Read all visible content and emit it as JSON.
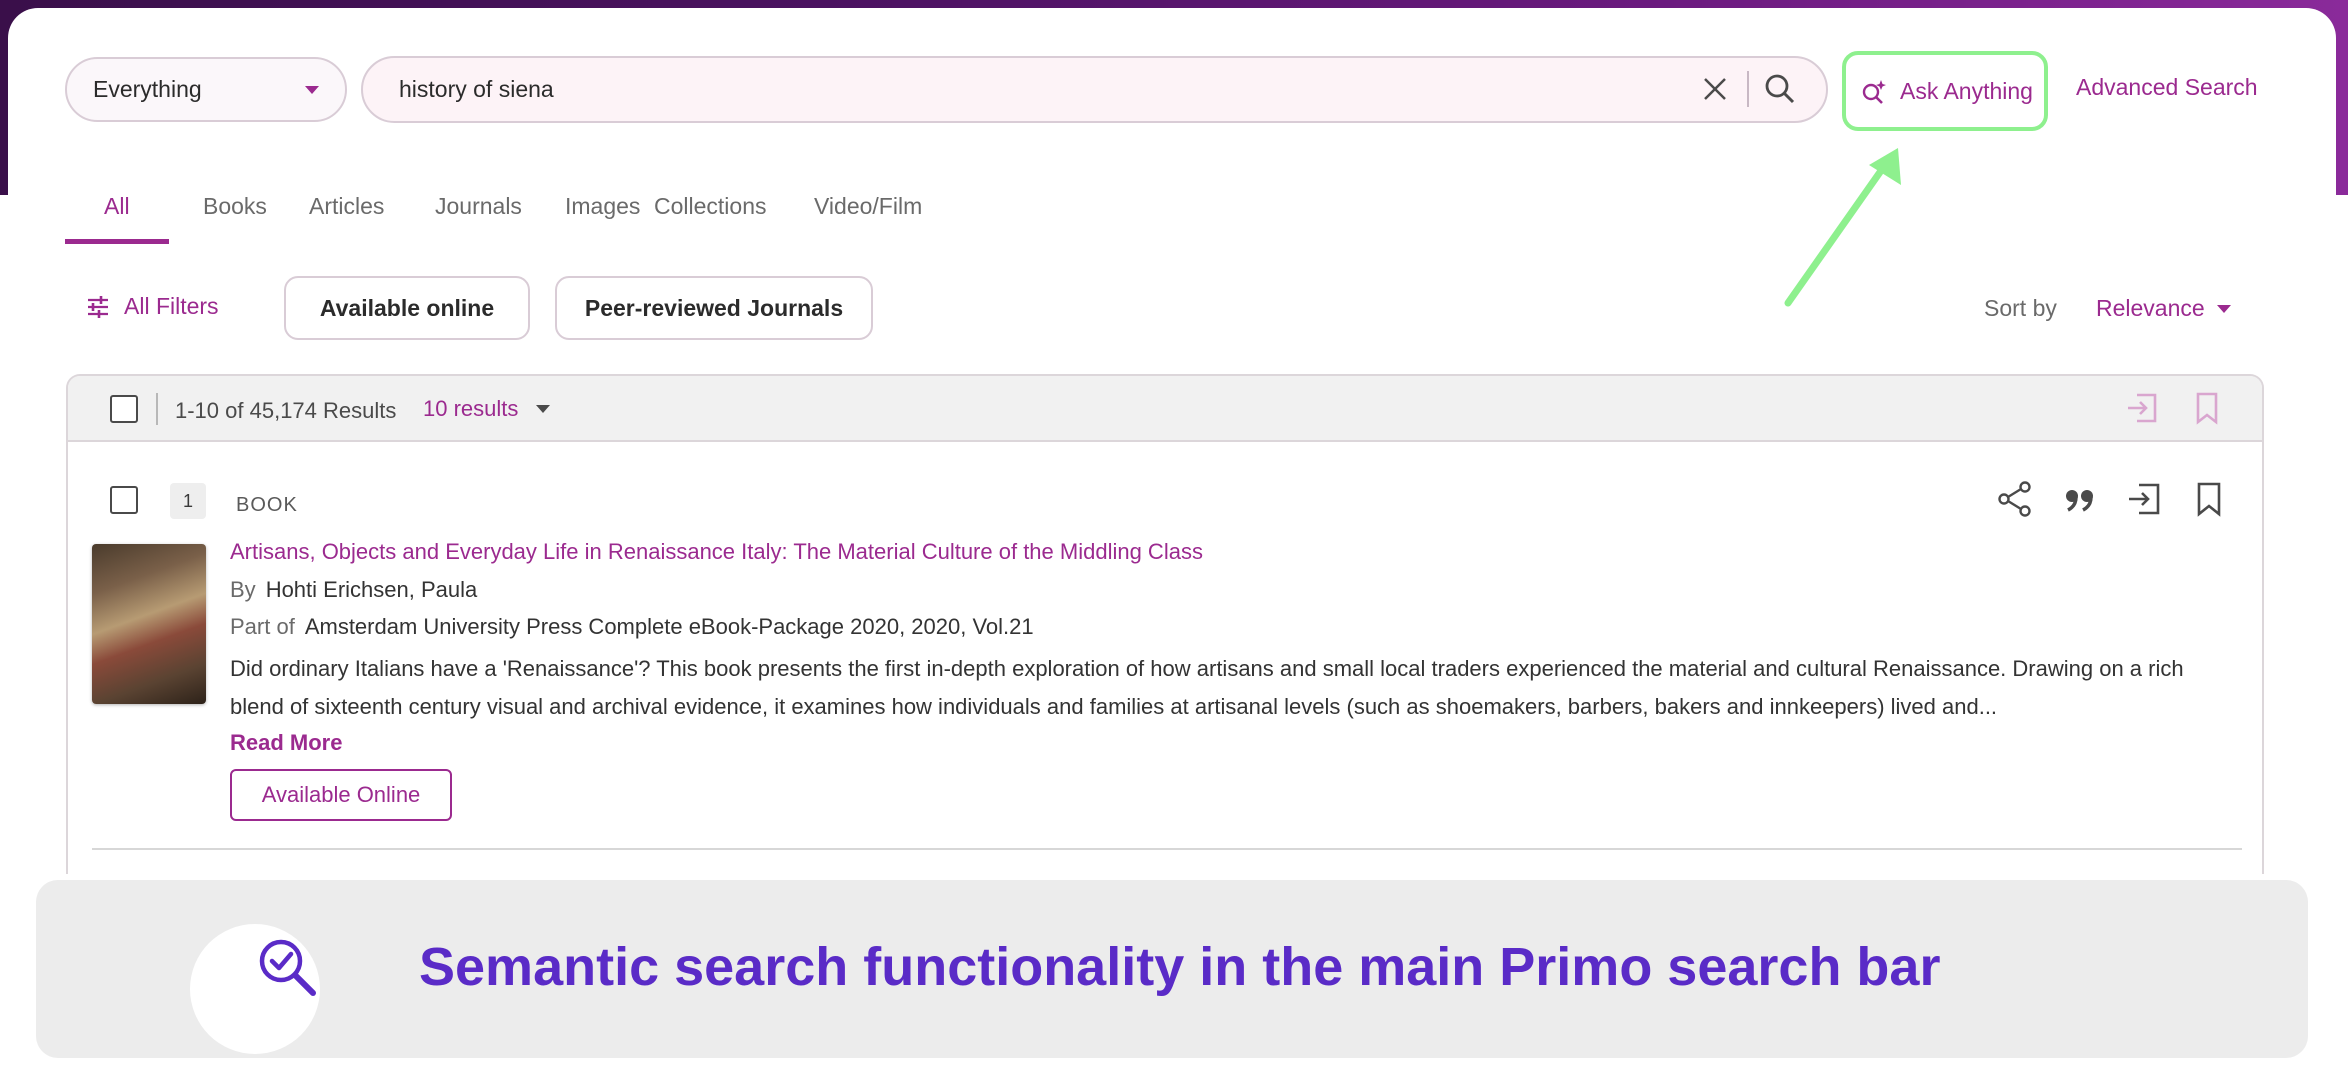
{
  "search": {
    "scope": "Everything",
    "query": "history of siena",
    "ask_anything_label": "Ask Anything",
    "advanced_search_label": "Advanced Search"
  },
  "tabs": [
    {
      "label": "All",
      "active": true
    },
    {
      "label": "Books"
    },
    {
      "label": "Articles"
    },
    {
      "label": "Journals"
    },
    {
      "label": "Images"
    },
    {
      "label": "Collections"
    },
    {
      "label": "Video/Film"
    }
  ],
  "filters": {
    "all_filters_label": "All Filters",
    "chips": [
      "Available online",
      "Peer-reviewed Journals"
    ],
    "sort_label": "Sort by",
    "sort_value": "Relevance"
  },
  "results_header": {
    "count_text": "1-10 of 45,174 Results",
    "per_page": "10 results"
  },
  "results": [
    {
      "number": "1",
      "type": "BOOK",
      "title": "Artisans, Objects and Everyday Life in Renaissance Italy: The Material Culture of the Middling Class",
      "by_label": "By",
      "author": "Hohti Erichsen, Paula",
      "part_of_label": "Part of",
      "part_of": "Amsterdam University Press Complete eBook-Package 2020, 2020, Vol.21",
      "description": "Did ordinary Italians have a 'Renaissance'? This book presents the first in-depth exploration of how artisans and small local traders experienced the material and cultural Renaissance. Drawing on a rich blend of sixteenth century visual and archival evidence, it examines how individuals and families at artisanal levels (such as shoemakers, barbers, bakers and innkeepers) lived and...",
      "read_more": "Read More",
      "availability": "Available Online"
    }
  ],
  "caption": {
    "text": "Semantic search functionality in the main Primo search bar"
  },
  "colors": {
    "accent": "#9b2a8f",
    "highlight": "#8ef08e",
    "caption_text": "#5a2bc7"
  }
}
